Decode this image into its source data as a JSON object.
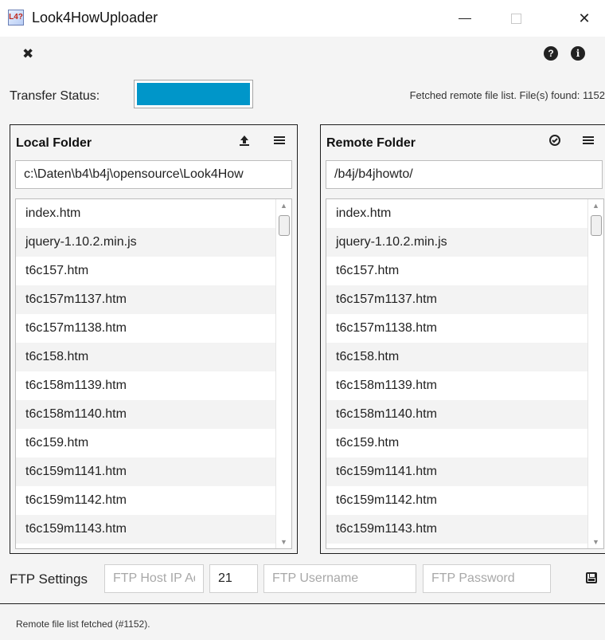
{
  "window": {
    "title": "Look4HowUploader",
    "icon_text": "L4?"
  },
  "toolbar": {
    "close_icon": "✖",
    "help_icon": "?",
    "info_icon": "i"
  },
  "transfer": {
    "label": "Transfer Status:",
    "progress_percent": 100,
    "progress_color": "#0096c9",
    "status_message": "Fetched remote file list. File(s) found: 1152"
  },
  "local": {
    "title": "Local Folder",
    "upload_icon": "upload-icon",
    "menu_icon": "menu-icon",
    "path": "c:\\Daten\\b4\\b4j\\opensource\\Look4How",
    "files": [
      "index.htm",
      "jquery-1.10.2.min.js",
      "t6c157.htm",
      "t6c157m1137.htm",
      "t6c157m1138.htm",
      "t6c158.htm",
      "t6c158m1139.htm",
      "t6c158m1140.htm",
      "t6c159.htm",
      "t6c159m1141.htm",
      "t6c159m1142.htm",
      "t6c159m1143.htm"
    ]
  },
  "remote": {
    "title": "Remote Folder",
    "check_icon": "check-circle-icon",
    "menu_icon": "menu-icon",
    "path": "/b4j/b4jhowto/",
    "files": [
      "index.htm",
      "jquery-1.10.2.min.js",
      "t6c157.htm",
      "t6c157m1137.htm",
      "t6c157m1138.htm",
      "t6c158.htm",
      "t6c158m1139.htm",
      "t6c158m1140.htm",
      "t6c159.htm",
      "t6c159m1141.htm",
      "t6c159m1142.htm",
      "t6c159m1143.htm"
    ]
  },
  "ftp": {
    "label": "FTP Settings",
    "host_placeholder": "FTP Host IP Address",
    "port_value": "21",
    "username_placeholder": "FTP Username",
    "password_placeholder": "FTP Password",
    "save_icon": "save-icon"
  },
  "statusbar": {
    "message": "Remote file list fetched (#1152)."
  }
}
